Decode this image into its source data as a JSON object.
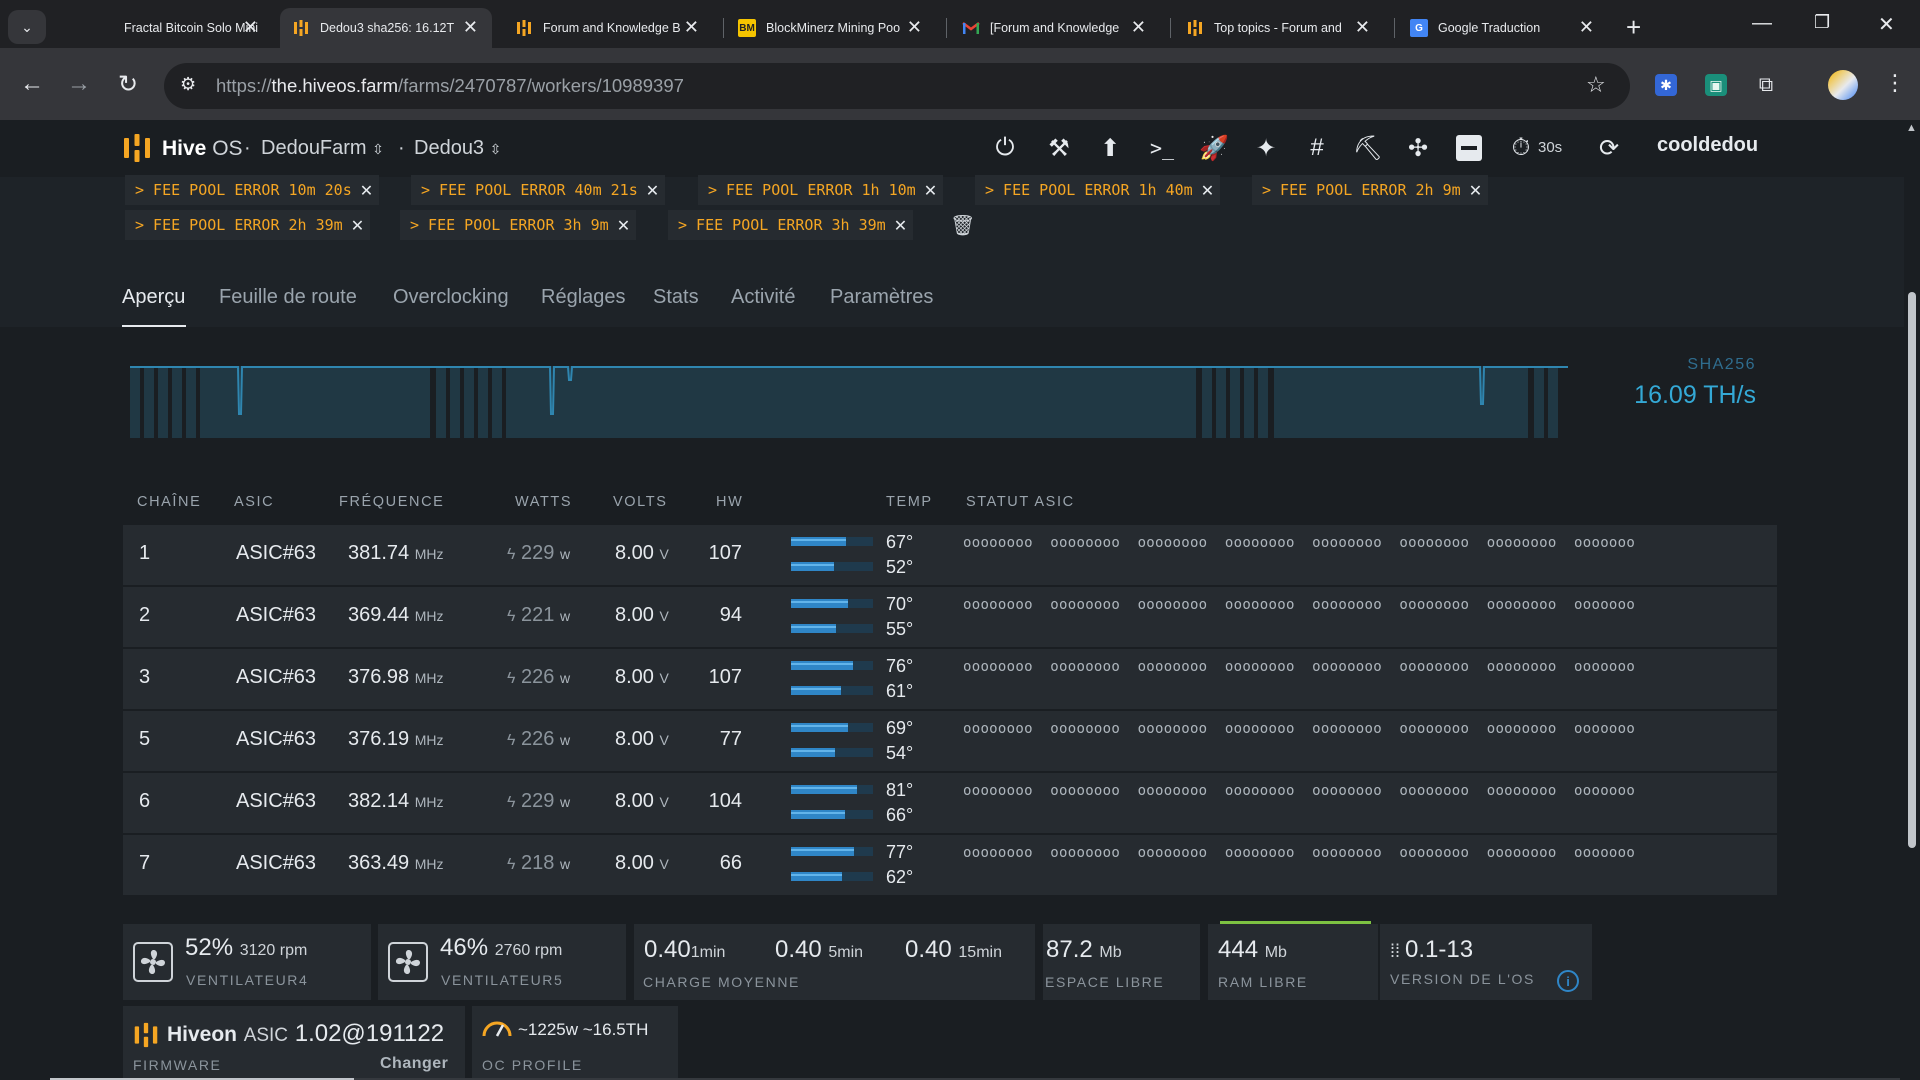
{
  "browser": {
    "tabs": [
      {
        "title": "Fractal Bitcoin Solo Mini",
        "icon": "fractal-icon",
        "active": false
      },
      {
        "title": "Dedou3 sha256: 16.12T",
        "icon": "hiveos-icon",
        "active": true
      },
      {
        "title": "Forum and Knowledge B",
        "icon": "hiveos-icon",
        "active": false
      },
      {
        "title": "BlockMinerz Mining Poo",
        "icon": "blockminerz-icon",
        "active": false
      },
      {
        "title": "[Forum and Knowledge",
        "icon": "gmail-icon",
        "active": false
      },
      {
        "title": "Top topics - Forum and",
        "icon": "hiveos-icon",
        "active": false
      },
      {
        "title": "Google Traduction",
        "icon": "google-translate-icon",
        "active": false
      }
    ],
    "url_prefix": "https://",
    "url_host": "the.hiveos.farm",
    "url_path": "/farms/2470787/workers/10989397"
  },
  "header": {
    "brand_bold": "Hive",
    "brand_rest": "OS",
    "separator": "·",
    "farm": "DedouFarm",
    "worker": "Dedou3",
    "timer": "30s",
    "user": "cooldedou",
    "icons": [
      "power-icon",
      "tools-icon",
      "upgrade-icon",
      "terminal-icon",
      "rocket-icon",
      "magic-wand-icon",
      "hash-icon",
      "pickaxe-icon",
      "fan-control-icon",
      "minus-icon",
      "stopwatch-icon",
      "refresh-icon"
    ]
  },
  "errors": [
    {
      "text": "> FEE POOL ERROR 10m 20s"
    },
    {
      "text": "> FEE POOL ERROR 40m 21s"
    },
    {
      "text": "> FEE POOL ERROR 1h 10m"
    },
    {
      "text": "> FEE POOL ERROR 1h 40m"
    },
    {
      "text": "> FEE POOL ERROR 2h 9m"
    },
    {
      "text": "> FEE POOL ERROR 2h 39m"
    },
    {
      "text": "> FEE POOL ERROR 3h 9m"
    },
    {
      "text": "> FEE POOL ERROR 3h 39m"
    }
  ],
  "subtabs": [
    "Aperçu",
    "Feuille de route",
    "Overclocking",
    "Réglages",
    "Stats",
    "Activité",
    "Paramètres"
  ],
  "hashrate": {
    "algo": "SHA256",
    "value": "16.09 TH/s"
  },
  "table": {
    "headers": [
      "CHAÎNE",
      "ASIC",
      "FRÉQUENCE",
      "WATTS",
      "VOLTS",
      "HW",
      "TEMP",
      "STATUT ASIC"
    ],
    "rows": [
      {
        "chain": "1",
        "asic": "ASIC#63",
        "freq": "381.74",
        "freq_unit": "MHz",
        "watts": "229",
        "watts_unit": "w",
        "volts": "8.00",
        "volts_unit": "V",
        "hw": "107",
        "temp_hi": "67°",
        "temp_lo": "52°",
        "temp_hi_pct": 0.67,
        "temp_lo_pct": 0.52,
        "status": "oooooooo  oooooooo  oooooooo  oooooooo  oooooooo  oooooooo  oooooooo  ooooooo"
      },
      {
        "chain": "2",
        "asic": "ASIC#63",
        "freq": "369.44",
        "freq_unit": "MHz",
        "watts": "221",
        "watts_unit": "w",
        "volts": "8.00",
        "volts_unit": "V",
        "hw": "94",
        "temp_hi": "70°",
        "temp_lo": "55°",
        "temp_hi_pct": 0.7,
        "temp_lo_pct": 0.55,
        "status": "oooooooo  oooooooo  oooooooo  oooooooo  oooooooo  oooooooo  oooooooo  ooooooo"
      },
      {
        "chain": "3",
        "asic": "ASIC#63",
        "freq": "376.98",
        "freq_unit": "MHz",
        "watts": "226",
        "watts_unit": "w",
        "volts": "8.00",
        "volts_unit": "V",
        "hw": "107",
        "temp_hi": "76°",
        "temp_lo": "61°",
        "temp_hi_pct": 0.76,
        "temp_lo_pct": 0.61,
        "status": "oooooooo  oooooooo  oooooooo  oooooooo  oooooooo  oooooooo  oooooooo  ooooooo"
      },
      {
        "chain": "5",
        "asic": "ASIC#63",
        "freq": "376.19",
        "freq_unit": "MHz",
        "watts": "226",
        "watts_unit": "w",
        "volts": "8.00",
        "volts_unit": "V",
        "hw": "77",
        "temp_hi": "69°",
        "temp_lo": "54°",
        "temp_hi_pct": 0.69,
        "temp_lo_pct": 0.54,
        "status": "oooooooo  oooooooo  oooooooo  oooooooo  oooooooo  oooooooo  oooooooo  ooooooo"
      },
      {
        "chain": "6",
        "asic": "ASIC#63",
        "freq": "382.14",
        "freq_unit": "MHz",
        "watts": "229",
        "watts_unit": "w",
        "volts": "8.00",
        "volts_unit": "V",
        "hw": "104",
        "temp_hi": "81°",
        "temp_lo": "66°",
        "temp_hi_pct": 0.81,
        "temp_lo_pct": 0.66,
        "status": "oooooooo  oooooooo  oooooooo  oooooooo  oooooooo  oooooooo  oooooooo  ooooooo"
      },
      {
        "chain": "7",
        "asic": "ASIC#63",
        "freq": "363.49",
        "freq_unit": "MHz",
        "watts": "218",
        "watts_unit": "w",
        "volts": "8.00",
        "volts_unit": "V",
        "hw": "66",
        "temp_hi": "77°",
        "temp_lo": "62°",
        "temp_hi_pct": 0.77,
        "temp_lo_pct": 0.62,
        "status": "oooooooo  oooooooo  oooooooo  oooooooo  oooooooo  oooooooo  oooooooo  ooooooo"
      }
    ]
  },
  "stats": {
    "fan4": {
      "pct": "52%",
      "rpm": "3120 rpm",
      "label": "VENTILATEUR4"
    },
    "fan5": {
      "pct": "46%",
      "rpm": "2760 rpm",
      "label": "VENTILATEUR5"
    },
    "load": {
      "v1": "0.40",
      "u1": "1min",
      "v5": "0.40",
      "u5": "5min",
      "v15": "0.40",
      "u15": "15min",
      "label": "CHARGE MOYENNE"
    },
    "disk": {
      "value": "87.2",
      "unit": "Mb",
      "label": "ESPACE LIBRE"
    },
    "ram": {
      "value": "444",
      "unit": "Mb",
      "label": "RAM LIBRE"
    },
    "os": {
      "value": "0.1-13",
      "label": "VERSION DE L'OS"
    },
    "firmware": {
      "brand": "Hiveon",
      "brand_suffix": "ASIC",
      "version": "1.02@191122",
      "label": "FIRMWARE",
      "change": "Changer"
    },
    "oc": {
      "value": "~1225w ~16.5TH",
      "label": "OC PROFILE"
    }
  },
  "colors": {
    "accent": "#34a9d6",
    "error": "#f5a623",
    "ram_ok": "#7dc242",
    "logo": "#f5a623"
  }
}
